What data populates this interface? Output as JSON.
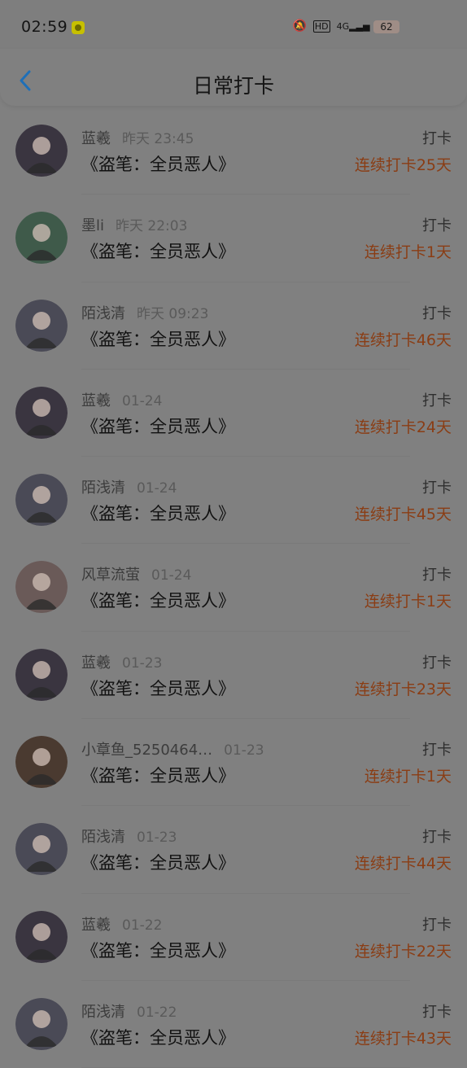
{
  "status_bar": {
    "time": "02:59",
    "battery": "62",
    "icons": [
      "app-icon",
      "mute-icon",
      "hd-icon",
      "4g-signal-icon",
      "wifi-icon",
      "charging-icon",
      "battery-icon"
    ]
  },
  "header": {
    "title": "日常打卡",
    "back_icon": "chevron-left-icon"
  },
  "records": [
    {
      "user": "蓝羲",
      "time": "昨天 23:45",
      "book": "《盗笔：全员恶人》",
      "action": "打卡",
      "streak": "连续打卡25天",
      "avatar_color": "#3a3540"
    },
    {
      "user": "墨li",
      "time": "昨天 22:03",
      "book": "《盗笔：全员恶人》",
      "action": "打卡",
      "streak": "连续打卡1天",
      "avatar_color": "#3f5a4a"
    },
    {
      "user": "陌浅清",
      "time": "昨天 09:23",
      "book": "《盗笔：全员恶人》",
      "action": "打卡",
      "streak": "连续打卡46天",
      "avatar_color": "#4a4a56"
    },
    {
      "user": "蓝羲",
      "time": "01-24",
      "book": "《盗笔：全员恶人》",
      "action": "打卡",
      "streak": "连续打卡24天",
      "avatar_color": "#3a3540"
    },
    {
      "user": "陌浅清",
      "time": "01-24",
      "book": "《盗笔：全员恶人》",
      "action": "打卡",
      "streak": "连续打卡45天",
      "avatar_color": "#4a4a56"
    },
    {
      "user": "风草流萤",
      "time": "01-24",
      "book": "《盗笔：全员恶人》",
      "action": "打卡",
      "streak": "连续打卡1天",
      "avatar_color": "#6a5a58"
    },
    {
      "user": "蓝羲",
      "time": "01-23",
      "book": "《盗笔：全员恶人》",
      "action": "打卡",
      "streak": "连续打卡23天",
      "avatar_color": "#3a3540"
    },
    {
      "user": "小章鱼_5250464…",
      "time": "01-23",
      "book": "《盗笔：全员恶人》",
      "action": "打卡",
      "streak": "连续打卡1天",
      "avatar_color": "#4a3a30"
    },
    {
      "user": "陌浅清",
      "time": "01-23",
      "book": "《盗笔：全员恶人》",
      "action": "打卡",
      "streak": "连续打卡44天",
      "avatar_color": "#4a4a56"
    },
    {
      "user": "蓝羲",
      "time": "01-22",
      "book": "《盗笔：全员恶人》",
      "action": "打卡",
      "streak": "连续打卡22天",
      "avatar_color": "#3a3540"
    },
    {
      "user": "陌浅清",
      "time": "01-22",
      "book": "《盗笔：全员恶人》",
      "action": "打卡",
      "streak": "连续打卡43天",
      "avatar_color": "#4a4a56"
    }
  ],
  "colors": {
    "accent": "#e0651f",
    "back": "#1e7fd6"
  }
}
